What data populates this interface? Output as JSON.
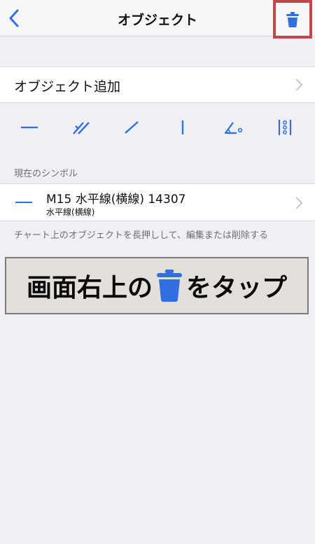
{
  "navbar": {
    "title": "オブジェクト",
    "back_icon": "chevron-left-icon",
    "trash_icon": "trash-icon"
  },
  "add_object": {
    "label": "オブジェクト追加"
  },
  "toolbar": {
    "tools": [
      "horizontal-line-icon",
      "parallel-lines-icon",
      "trend-line-icon",
      "vertical-line-icon",
      "angle-icon",
      "vertical-dots-icon"
    ]
  },
  "section": {
    "header": "現在のシンボル"
  },
  "symbol": {
    "title": "M15 水平線(横線) 14307",
    "subtitle": "水平線(横線)"
  },
  "footer": {
    "note": "チャート上のオブジェクトを長押しして、編集または削除する"
  },
  "banner": {
    "text_before": "画面右上の",
    "text_after": "をタップ"
  },
  "colors": {
    "accent": "#2f6fe2",
    "highlight_border": "#c0484d",
    "banner_bg": "#e3dfdb"
  }
}
